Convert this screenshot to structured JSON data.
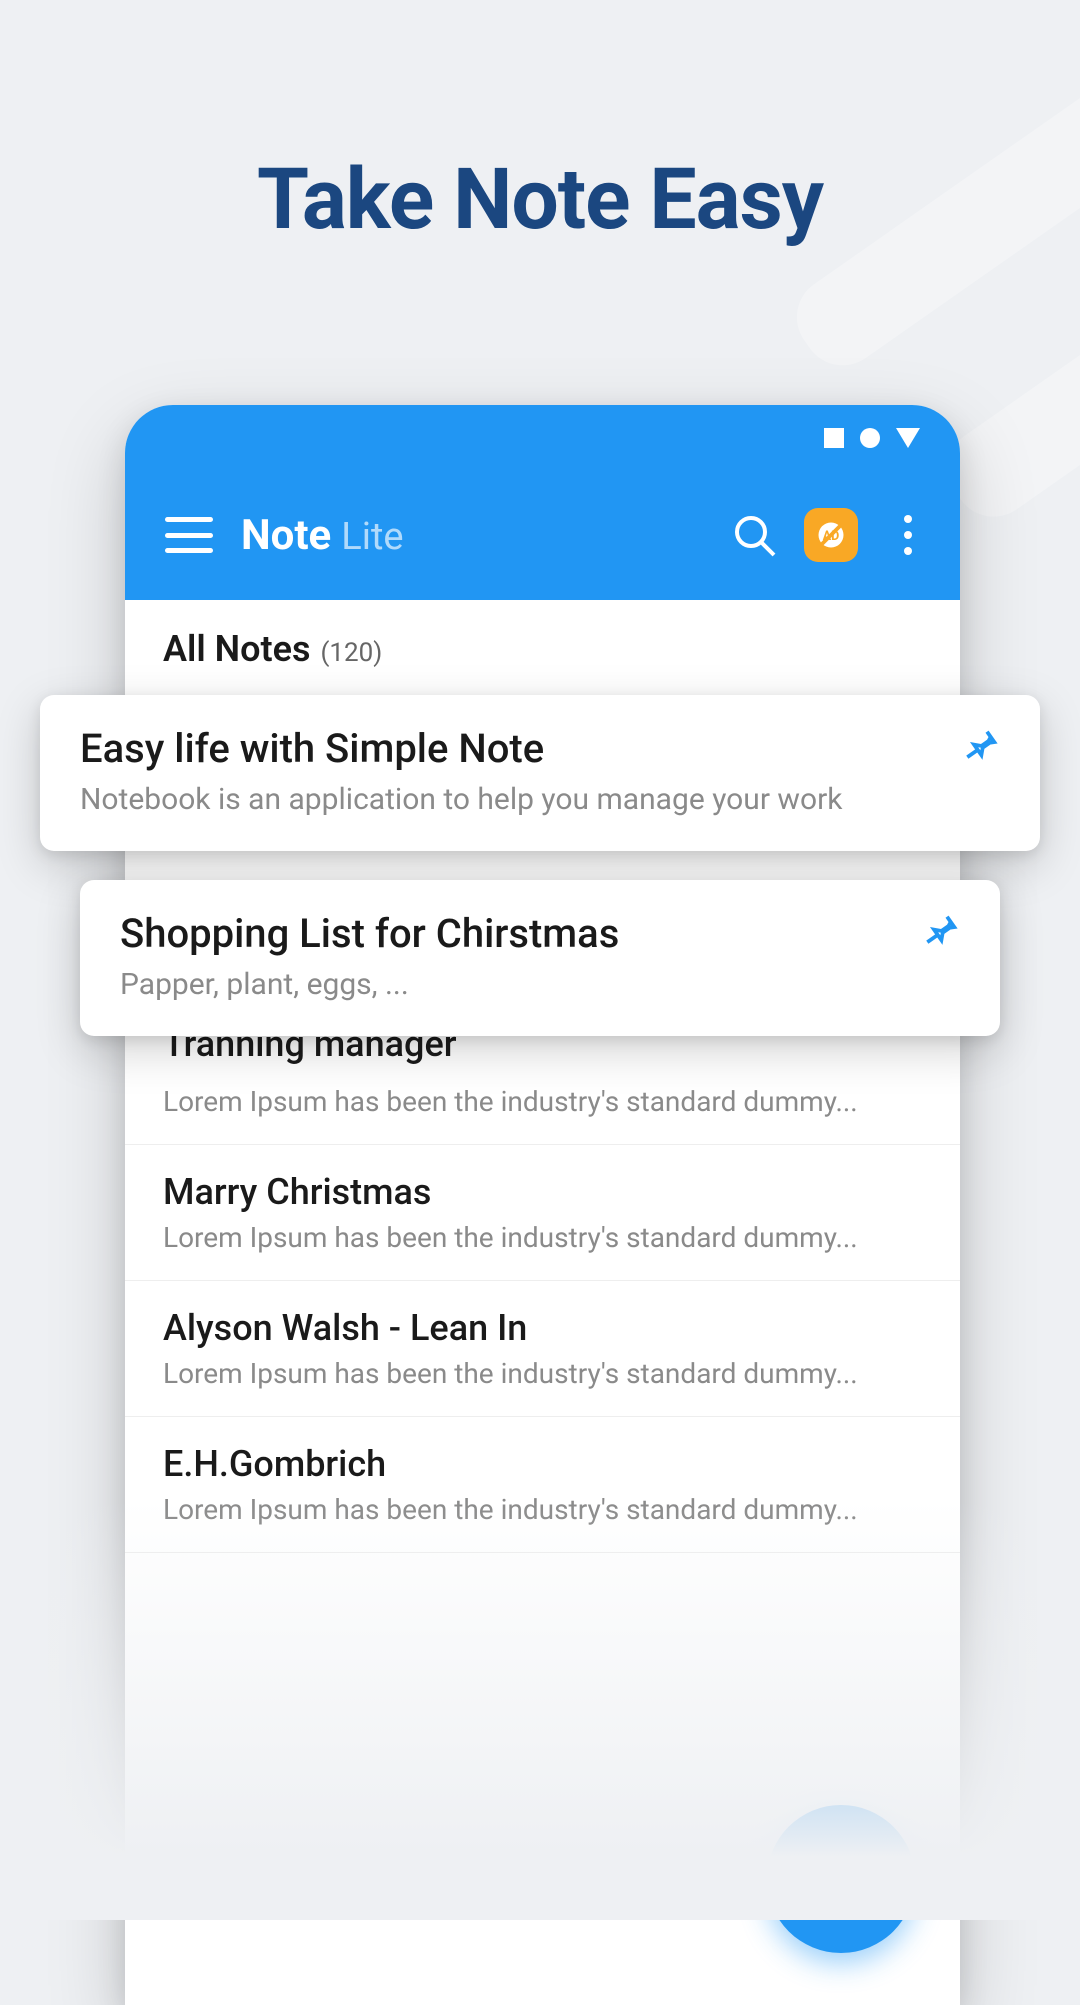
{
  "headline": "Take Note Easy",
  "app": {
    "title_main": "Note",
    "title_sub": "Lite"
  },
  "section": {
    "title": "All Notes",
    "count": "(120)"
  },
  "floating_cards": [
    {
      "title": "Easy life with Simple Note",
      "preview": "Notebook is an application to help you manage your work"
    },
    {
      "title": "Shopping List for Chirstmas",
      "preview": "Papper, plant, eggs, ..."
    }
  ],
  "notes": [
    {
      "title": "Tranning manager",
      "preview": "Lorem Ipsum has been the industry's standard dummy..."
    },
    {
      "title": "Marry Christmas",
      "preview": "Lorem Ipsum has been the industry's standard dummy..."
    },
    {
      "title": "Alyson Walsh - Lean In",
      "preview": "Lorem Ipsum has been the industry's standard dummy..."
    },
    {
      "title": "E.H.Gombrich",
      "preview": "Lorem Ipsum has been the industry's standard dummy..."
    }
  ],
  "colors": {
    "primary": "#2196f3",
    "headline": "#1b4780",
    "ad_badge": "#f9a825"
  }
}
